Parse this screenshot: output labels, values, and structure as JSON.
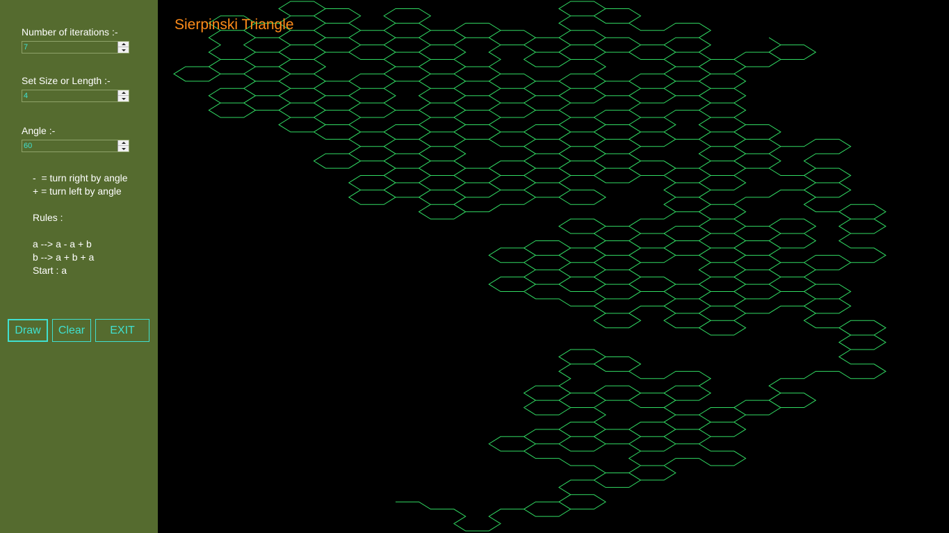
{
  "sidebar": {
    "iterations": {
      "label": "Number of iterations :-",
      "value": "7"
    },
    "size": {
      "label": "Set Size or Length :-",
      "value": "4"
    },
    "angle": {
      "label": "Angle :-",
      "value": "60"
    },
    "legend": {
      "minus": "-  = turn right by angle",
      "plus": "+ = turn left by angle"
    },
    "rules": {
      "heading": "Rules :",
      "rule_a": "a --> a - a + b",
      "rule_b": "b --> a + b + a",
      "start": "Start : a"
    },
    "buttons": {
      "draw": "Draw",
      "clear": "Clear",
      "exit": "EXIT"
    }
  },
  "canvas": {
    "title": "Sierpinski Triangle",
    "iterations": 7,
    "angle_degrees": 60,
    "axiom": "a",
    "rules": {
      "a": "a-a+b",
      "b": "a+b+a"
    }
  },
  "colors": {
    "sidebar_bg": "#556b2f",
    "canvas_bg": "#000000",
    "curve": "#32dc64",
    "title": "#ff8c1a",
    "accent": "#40e0d0"
  },
  "icons": {
    "spin_up": "chevron-up-icon",
    "spin_down": "chevron-down-icon"
  }
}
